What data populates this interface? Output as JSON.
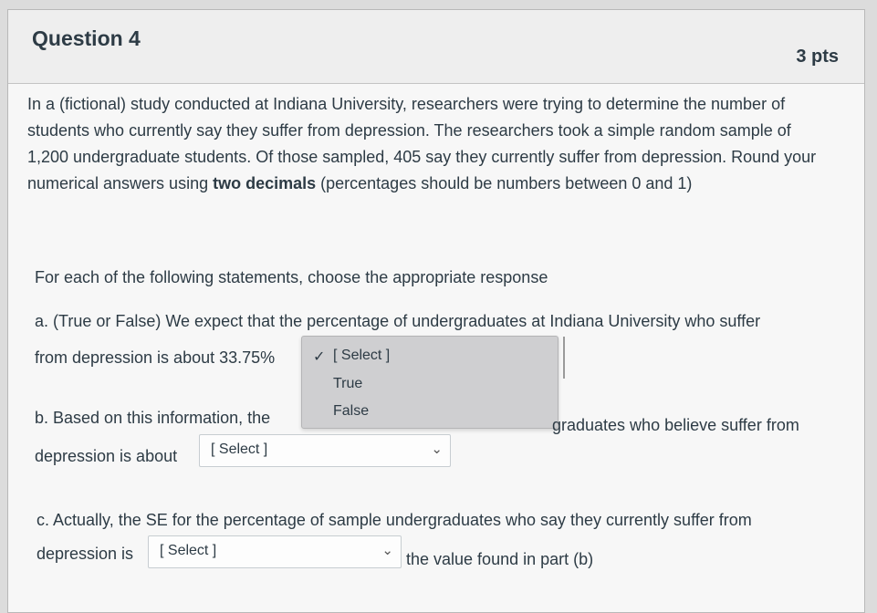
{
  "question": {
    "title": "Question 4",
    "points": "3 pts"
  },
  "body": {
    "p1_before_bold": "In a (fictional) study conducted at Indiana University, researchers were trying to determine the number of students who currently say they suffer from depression. The researchers took a simple random sample of 1,200 undergraduate students. Of those sampled, 405 say they currently suffer from depression. Round your numerical answers using ",
    "p1_bold": "two decimals",
    "p1_after_bold": " (percentages should be numbers between 0 and 1)",
    "instruction": "For each of the following statements, choose the appropriate response"
  },
  "part_a": {
    "line1": "a. (True or False) We expect that the percentage of undergraduates at Indiana University who suffer",
    "line2": "from depression is about 33.75%",
    "select_label": "[ Select ]",
    "options": [
      "True",
      "False"
    ],
    "checkmark": "✓"
  },
  "part_b": {
    "line1_start": "b. Based on this information, the",
    "line1_end": "graduates who believe suffer from",
    "line2": "depression is about",
    "select_label": "[ Select ]"
  },
  "part_c": {
    "line1": "c. Actually, the SE for the percentage of sample undergraduates who say they currently suffer from",
    "line2_start": "depression is",
    "select_label": "[ Select ]",
    "line2_end": "the value found in part (b)"
  }
}
